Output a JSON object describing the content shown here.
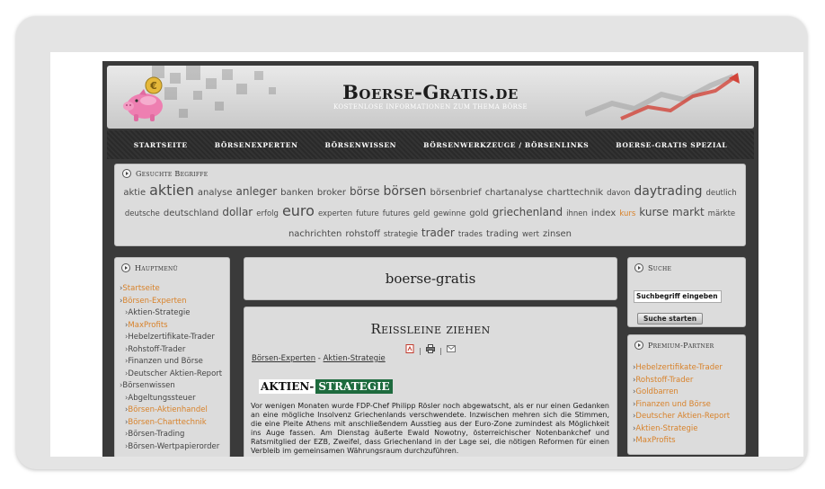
{
  "header": {
    "title": "Boerse-Gratis.de",
    "subtitle": "KOSTENLOSE INFORMATIONEN ZUM THEMA BÖRSE",
    "coin_symbol": "€"
  },
  "nav": {
    "items": [
      "STARTSEITE",
      "BÖRSENEXPERTEN",
      "BÖRSENWISSEN",
      "BÖRSENWERKZEUGE / BÖRSENLINKS",
      "BOERSE-GRATIS SPEZIAL"
    ]
  },
  "tags": {
    "heading": "Gesuchte Begriffe",
    "line1": [
      {
        "t": "aktie",
        "s": 2
      },
      {
        "t": "aktien",
        "s": 5
      },
      {
        "t": "analyse",
        "s": 2
      },
      {
        "t": "anleger",
        "s": 3
      },
      {
        "t": "banken",
        "s": 2
      },
      {
        "t": "broker",
        "s": 2
      },
      {
        "t": "börse",
        "s": 3
      },
      {
        "t": "börsen",
        "s": 4
      },
      {
        "t": "börsenbrief",
        "s": 2
      },
      {
        "t": "chartanalyse",
        "s": 2
      },
      {
        "t": "charttechnik",
        "s": 2
      },
      {
        "t": "davon",
        "s": 1
      },
      {
        "t": "daytrading",
        "s": 4
      },
      {
        "t": "deutlich",
        "s": 1
      }
    ],
    "line2": [
      {
        "t": "deutsche",
        "s": 1
      },
      {
        "t": "deutschland",
        "s": 2
      },
      {
        "t": "dollar",
        "s": 3
      },
      {
        "t": "erfolg",
        "s": 1
      },
      {
        "t": "euro",
        "s": 5
      },
      {
        "t": "experten",
        "s": 1
      },
      {
        "t": "future",
        "s": 1
      },
      {
        "t": "futures",
        "s": 1
      },
      {
        "t": "geld",
        "s": 1
      },
      {
        "t": "gewinne",
        "s": 1
      },
      {
        "t": "gold",
        "s": 2
      },
      {
        "t": "griechenland",
        "s": 3
      },
      {
        "t": "ihnen",
        "s": 1
      },
      {
        "t": "index",
        "s": 2
      },
      {
        "t": "kurs",
        "s": 1,
        "hl": true
      },
      {
        "t": "kurse",
        "s": 3
      },
      {
        "t": "markt",
        "s": 3
      },
      {
        "t": "märkte",
        "s": 1
      }
    ],
    "line3": [
      {
        "t": "nachrichten",
        "s": 2
      },
      {
        "t": "rohstoff",
        "s": 2
      },
      {
        "t": "strategie",
        "s": 1
      },
      {
        "t": "trader",
        "s": 3
      },
      {
        "t": "trades",
        "s": 1
      },
      {
        "t": "trading",
        "s": 2
      },
      {
        "t": "wert",
        "s": 1
      },
      {
        "t": "zinsen",
        "s": 2
      }
    ]
  },
  "main_menu": {
    "heading": "Hauptmenü",
    "items": [
      {
        "label": "Startseite",
        "sub": false,
        "orange": true
      },
      {
        "label": "Börsen-Experten",
        "sub": false,
        "orange": true
      },
      {
        "label": "Aktien-Strategie",
        "sub": true,
        "orange": false
      },
      {
        "label": "MaxProfits",
        "sub": true,
        "orange": true
      },
      {
        "label": "Hebelzertifikate-Trader",
        "sub": true,
        "orange": false
      },
      {
        "label": "Rohstoff-Trader",
        "sub": true,
        "orange": false
      },
      {
        "label": "Finanzen und Börse",
        "sub": true,
        "orange": false
      },
      {
        "label": "Deutscher Aktien-Report",
        "sub": true,
        "orange": false
      },
      {
        "label": "Börsenwissen",
        "sub": false,
        "orange": false
      },
      {
        "label": "Abgeltungssteuer",
        "sub": true,
        "orange": false
      },
      {
        "label": "Börsen-Aktienhandel",
        "sub": true,
        "orange": true
      },
      {
        "label": "Börsen-Charttechnik",
        "sub": true,
        "orange": true
      },
      {
        "label": "Börsen-Trading",
        "sub": true,
        "orange": false
      },
      {
        "label": "Börsen-Wertpapierorder",
        "sub": true,
        "orange": false
      }
    ]
  },
  "content": {
    "site_box_title": "boerse-gratis",
    "article_title": "Reissleine ziehen",
    "tool_separator": "|",
    "crumb_a": "Börsen-Experten",
    "crumb_sep": " - ",
    "crumb_b": "Aktien-Strategie",
    "logo_part1": "AKTIEN-",
    "logo_part2": "STRATEGIE",
    "body": "Vor wenigen Monaten wurde FDP-Chef Philipp Rösler noch abgewatscht, als er nur einen Gedanken an eine mögliche Insolvenz Griechenlands verschwendete. Inzwischen mehren sich die Stimmen, die eine Pleite Athens mit anschließendem Ausstieg aus der Euro-Zone zumindest als Möglichkeit ins Auge fassen. Am Dienstag äußerte Ewald Nowotny, österreichischer Notenbankchef und Ratsmitglied der EZB, Zweifel, dass Griechenland in der Lage sei, die nötigen Reformen für einen Verbleib im gemeinsamen Währungsraum durchzuführen."
  },
  "search": {
    "heading": "Suche",
    "input_value": "Suchbegriff eingeben",
    "button_label": "Suche starten"
  },
  "partners": {
    "heading": "Premium-Partner",
    "items": [
      "Hebelzertifikate-Trader",
      "Rohstoff-Trader",
      "Goldbarren",
      "Finanzen und Börse",
      "Deutscher Aktien-Report",
      "Aktien-Strategie",
      "MaxProfits"
    ]
  },
  "colors": {
    "link_orange": "#d8822a",
    "logo_green": "#1e6b3e",
    "box_gray": "#dcdcdc",
    "page_dark": "#3a3a3a"
  }
}
